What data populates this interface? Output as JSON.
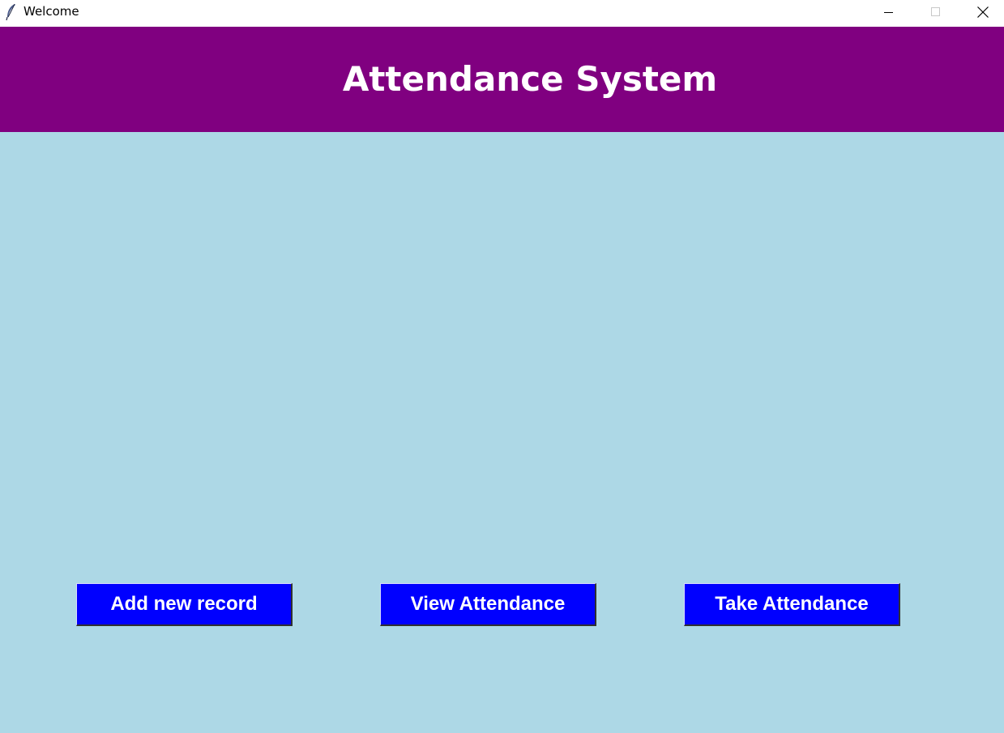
{
  "window": {
    "title": "Welcome",
    "icon": "feather-icon",
    "controls": [
      "minimize-icon",
      "maximize-icon",
      "close-icon"
    ]
  },
  "header": {
    "title": "Attendance System",
    "background": "#800080",
    "text_color": "#ffffff"
  },
  "main": {
    "background": "#add8e6"
  },
  "actions": {
    "add_label": "Add new record",
    "view_label": "View Attendance",
    "take_label": "Take Attendance",
    "button_color": "#0000ff",
    "button_text_color": "#ffffff"
  }
}
